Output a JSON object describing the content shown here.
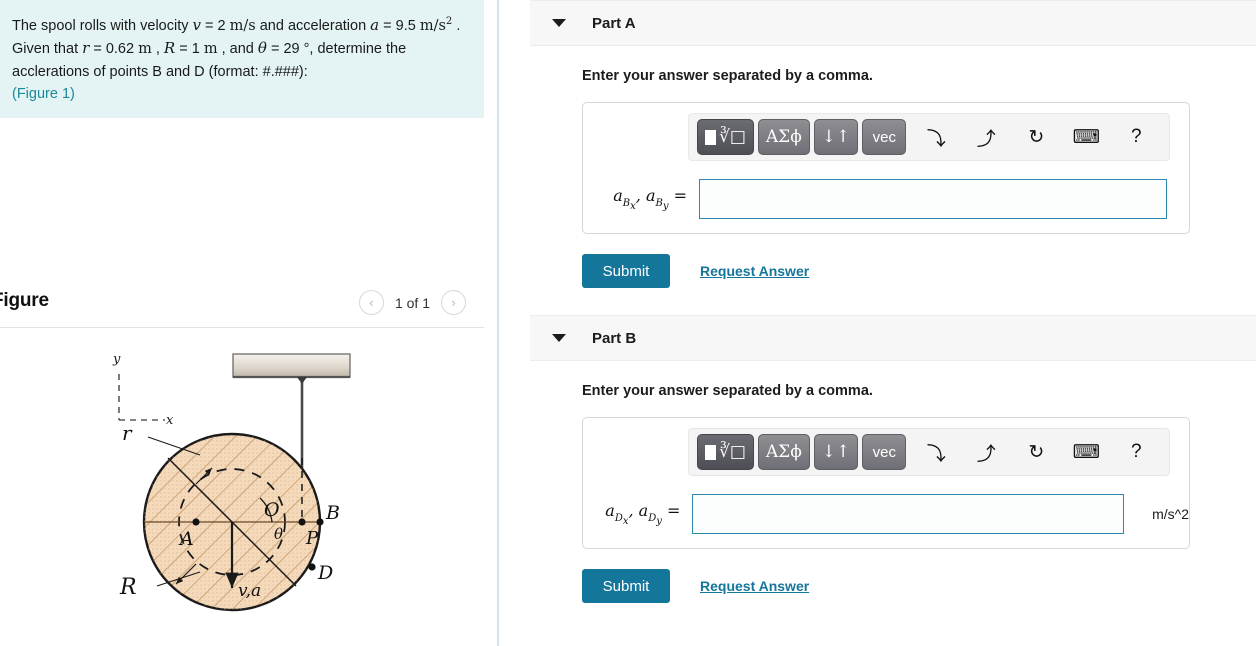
{
  "problem": {
    "text_1": "The spool rolls with velocity ",
    "v_sym": "v",
    "eq1": " = 2 ",
    "v_unit": "m/s",
    "text_2": " and acceleration ",
    "a_sym": "a",
    "eq2": " = 9.5 ",
    "a_unit": "m/s",
    "a_unit_exp": "2",
    "text_3": " . Given that ",
    "r_sym": "r",
    "r_val": " = 0.62 ",
    "r_unit": "m",
    "text_4": " , ",
    "R_sym": "R",
    "R_val": " = 1 ",
    "R_unit": "m",
    "text_5": " , and ",
    "theta_sym": "θ",
    "theta_val": " = 29 °",
    "text_6": ", determine the acclerations of points B and D (format: #.###):",
    "figure_link": "(Figure 1)"
  },
  "figure": {
    "title": "Figure",
    "pager_prev": "‹",
    "pager_label": "1 of 1",
    "pager_next": "›",
    "labels": {
      "axis_y": "y",
      "axis_x": "x",
      "r": "r",
      "R": "R",
      "O": "O",
      "A": "A",
      "B": "B",
      "P": "P",
      "D": "D",
      "theta": "θ",
      "va": "v,a"
    },
    "colors": {
      "spool_fill": "#f2d5b4",
      "spool_stroke": "#1a1a1a",
      "hatch": "#b08a5e",
      "ceiling_top": "#f0ece7",
      "ceiling_bottom": "#bdb3a7",
      "cord": "#4a4a4a"
    }
  },
  "parts": [
    {
      "id": "part-a",
      "label": "Part A",
      "caret": "collapse-caret",
      "instruction": "Enter your answer separated by a comma.",
      "answer_label_main": "a",
      "answer_label_sub1": "B",
      "answer_label_sub1x": "x",
      "answer_label_sub2": "B",
      "answer_label_sub2y": "y",
      "answer_value": "",
      "unit": "",
      "submit_label": "Submit",
      "request_label": "Request Answer"
    },
    {
      "id": "part-b",
      "label": "Part B",
      "caret": "collapse-caret",
      "instruction": "Enter your answer separated by a comma.",
      "answer_label_main": "a",
      "answer_label_sub1": "D",
      "answer_label_sub1x": "x",
      "answer_label_sub2": "D",
      "answer_label_sub2y": "y",
      "answer_value": "",
      "unit": "m/s^2",
      "submit_label": "Submit",
      "request_label": "Request Answer"
    }
  ],
  "toolbar": {
    "btn_sqrt": "√",
    "btn_greek": "ΑΣϕ",
    "btn_updown": "↓↑",
    "btn_vec": "vec",
    "icon_undo": "⬅",
    "icon_redo": "➡",
    "icon_reset": "↻",
    "icon_keyboard": "⌨",
    "icon_help": "?"
  },
  "colors": {
    "accent": "#15769b",
    "problem_bg": "#e4f4f4",
    "link": "#1a8a9a",
    "input_border": "#2b89ad",
    "divider": "#cfe3ec"
  }
}
